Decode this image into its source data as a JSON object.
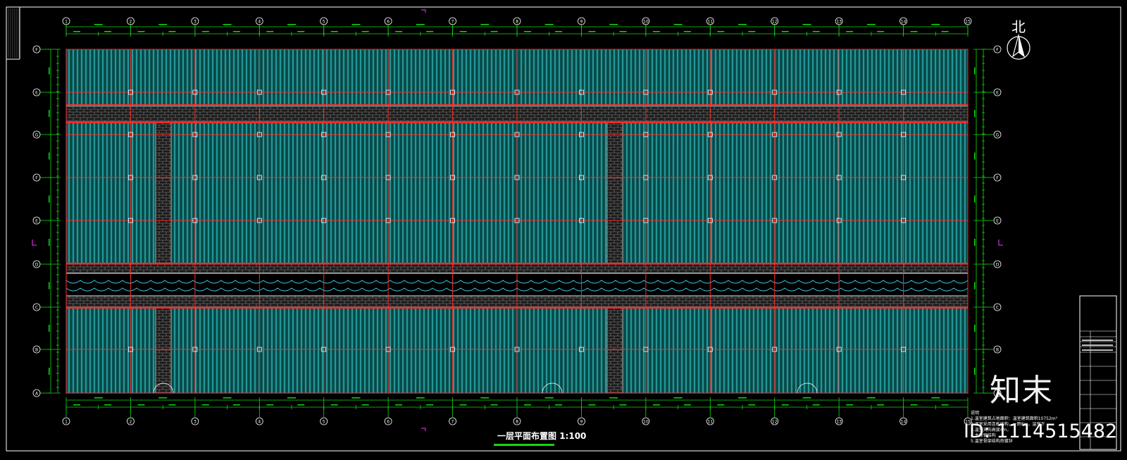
{
  "drawing": {
    "title": "一层平面布置图",
    "scale": "1:100",
    "north_label": "北",
    "column_axes": [
      "1",
      "2",
      "3",
      "4",
      "5",
      "6",
      "7",
      "8",
      "9",
      "10",
      "11",
      "12",
      "13",
      "14",
      "15"
    ],
    "row_axes": [
      "F",
      "E",
      "G",
      "F",
      "E",
      "D",
      "C",
      "B",
      "A"
    ],
    "notes_heading": "说明",
    "notes_lines": [
      "1.温室建筑占地面积：温室建筑面积10752m²",
      "2.温室采用连栋结构，一跨8m，温室下",
      "3.温室天沟高度4m，",
      "4.主体钢结构",
      "5.温室骨架结构热镀锌"
    ],
    "colors": {
      "background": "#000000",
      "frame": "#ffffff",
      "dimension": "#13d613",
      "grid_axis": "#ff2a2a",
      "panel_fill": "#0b5555",
      "panel_lines": "#3fd6d6",
      "brick": "#8a8a8a",
      "water": "#37c8e6",
      "marker": "#ff33ff"
    }
  },
  "watermark": {
    "logo": "知末",
    "id": "ID: 1114515482"
  }
}
